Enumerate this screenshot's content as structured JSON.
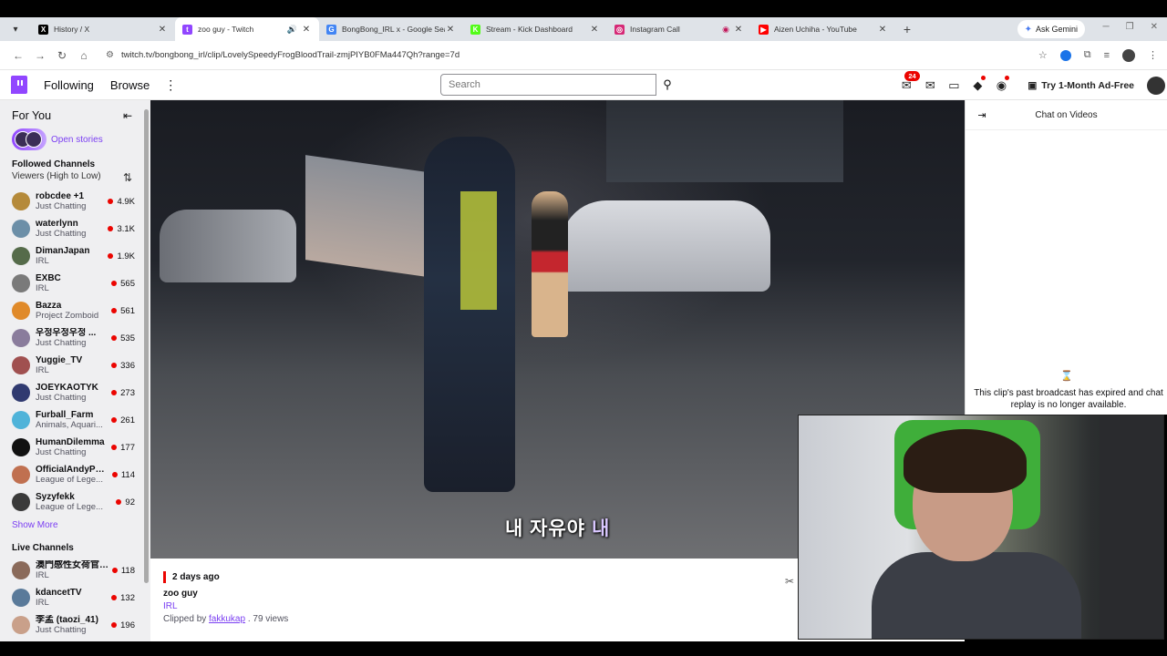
{
  "browser": {
    "tabs": [
      {
        "title": "History / X",
        "fav": "x-logo",
        "fav_color": "#000000",
        "fav_char": "X"
      },
      {
        "title": "zoo guy - Twitch",
        "fav": "twitch-logo",
        "fav_color": "#9146ff",
        "fav_char": "t",
        "active": true
      },
      {
        "title": "BongBong_IRL x - Google Search",
        "fav": "google-logo",
        "fav_color": "#4285f4",
        "fav_char": "G"
      },
      {
        "title": "Stream - Kick Dashboard",
        "fav": "kick-logo",
        "fav_color": "#53fc18",
        "fav_char": "K"
      },
      {
        "title": "Instagram Call",
        "fav": "instagram-logo",
        "fav_color": "#d62976",
        "fav_char": "◎"
      },
      {
        "title": "Aizen Uchiha - YouTube",
        "fav": "youtube-logo",
        "fav_color": "#ff0000",
        "fav_char": "▶"
      }
    ],
    "gemini_label": "Ask Gemini",
    "url": "twitch.tv/bongbong_irl/clip/LovelySpeedyFrogBloodTrail-zmjPIYB0FMa447Qh?range=7d"
  },
  "twitch_nav": {
    "following": "Following",
    "browse": "Browse",
    "search_placeholder": "Search",
    "notifications_count": "24",
    "ad_free": "Try 1-Month Ad-Free"
  },
  "sidebar": {
    "title": "For You",
    "stories_label": "Open stories",
    "followed_title": "Followed Channels",
    "followed_sort": "Viewers (High to Low)",
    "followed": [
      {
        "name": "robcdee +1",
        "category": "Just Chatting",
        "viewers": "4.9K",
        "color": "#b58a3a"
      },
      {
        "name": "waterlynn",
        "category": "Just Chatting",
        "viewers": "3.1K",
        "color": "#6c8fa8"
      },
      {
        "name": "DimanJapan",
        "category": "IRL",
        "viewers": "1.9K",
        "color": "#556b4a"
      },
      {
        "name": "EXBC",
        "category": "IRL",
        "viewers": "565",
        "color": "#7a7a7a"
      },
      {
        "name": "Bazza",
        "category": "Project Zomboid",
        "viewers": "561",
        "color": "#e08a2a"
      },
      {
        "name": "우정우정우정 ...",
        "category": "Just Chatting",
        "viewers": "535",
        "color": "#8a7c9c"
      },
      {
        "name": "Yuggie_TV",
        "category": "IRL",
        "viewers": "336",
        "color": "#a05050"
      },
      {
        "name": "JOEYKAOTYK",
        "category": "Just Chatting",
        "viewers": "273",
        "color": "#303a70"
      },
      {
        "name": "Furball_Farm",
        "category": "Animals, Aquari...",
        "viewers": "261",
        "color": "#4fb3d9"
      },
      {
        "name": "HumanDilemma",
        "category": "Just Chatting",
        "viewers": "177",
        "color": "#111111"
      },
      {
        "name": "OfficialAndyPyro",
        "category": "League of Lege...",
        "viewers": "114",
        "color": "#c07050"
      },
      {
        "name": "Syzyfekk",
        "category": "League of Lege...",
        "viewers": "92",
        "color": "#3a3a3a"
      }
    ],
    "show_more": "Show More",
    "live_title": "Live Channels",
    "live": [
      {
        "name": "澳門感性女荷官 (...",
        "category": "IRL",
        "viewers": "118",
        "color": "#8a6a5a"
      },
      {
        "name": "kdancetTV",
        "category": "IRL",
        "viewers": "132",
        "color": "#5a7a9a"
      },
      {
        "name": "李孟 (taozi_41)",
        "category": "Just Chatting",
        "viewers": "196",
        "color": "#c9a08a"
      }
    ]
  },
  "video": {
    "subtitle_main": "내 자유야 ",
    "subtitle_highlight": "내"
  },
  "clip": {
    "time": "2 days ago",
    "title": "zoo guy",
    "category": "IRL",
    "clipped_by_prefix": "Clipped by ",
    "clipper": "fakkukap",
    "views": " . 79 views"
  },
  "chat": {
    "title": "Chat on Videos",
    "message": "This clip's past broadcast has expired and chat replay is no longer available."
  }
}
